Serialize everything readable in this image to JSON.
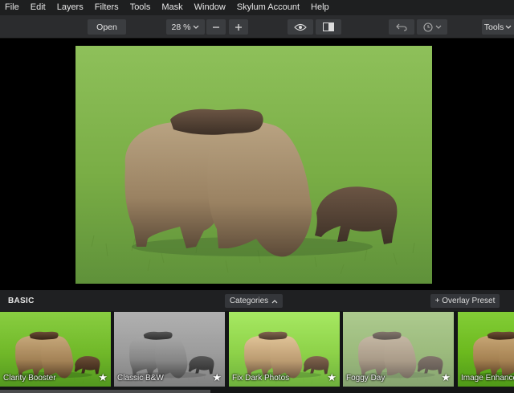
{
  "menu": [
    "File",
    "Edit",
    "Layers",
    "Filters",
    "Tools",
    "Mask",
    "Window",
    "Skylum Account",
    "Help"
  ],
  "toolbar": {
    "open_label": "Open",
    "zoom_label": "28 %",
    "tools_label": "Tools"
  },
  "presets": {
    "section_title": "BASIC",
    "categories_label": "Categories",
    "overlay_label": "+ Overlay Preset",
    "items": [
      {
        "label": "Clarity Booster",
        "filter": "saturate(1.2) contrast(1.15)"
      },
      {
        "label": "Classic B&W",
        "filter": "grayscale(1) contrast(1.05)"
      },
      {
        "label": "Fix Dark Photos",
        "filter": "brightness(1.2) saturate(1.1)"
      },
      {
        "label": "Foggy Day",
        "filter": "brightness(1.3) contrast(0.65) saturate(0.7)"
      },
      {
        "label": "Image Enhancer",
        "filter": "saturate(1.35) contrast(1.1)"
      }
    ]
  },
  "colors": {
    "menubar_bg": "#1e1f20",
    "toolbar_bg": "#2b2c2e",
    "button_bg": "#3b3d40"
  }
}
